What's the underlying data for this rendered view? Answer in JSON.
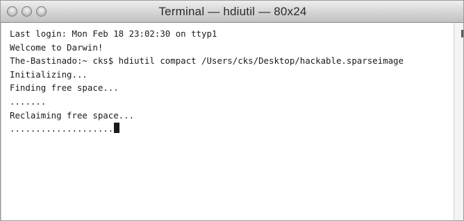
{
  "window": {
    "title": "Terminal — hdiutil — 80x24"
  },
  "terminal": {
    "lines": [
      "Last login: Mon Feb 18 23:02:30 on ttyp1",
      "Welcome to Darwin!",
      "The-Bastinado:~ cks$ hdiutil compact /Users/cks/Desktop/hackable.sparseimage",
      "Initializing...",
      "Finding free space...",
      ".......",
      "Reclaiming free space...",
      "...................."
    ]
  },
  "icons": {
    "close": "close-button-icon",
    "minimize": "minimize-button-icon",
    "zoom": "zoom-button-icon"
  }
}
